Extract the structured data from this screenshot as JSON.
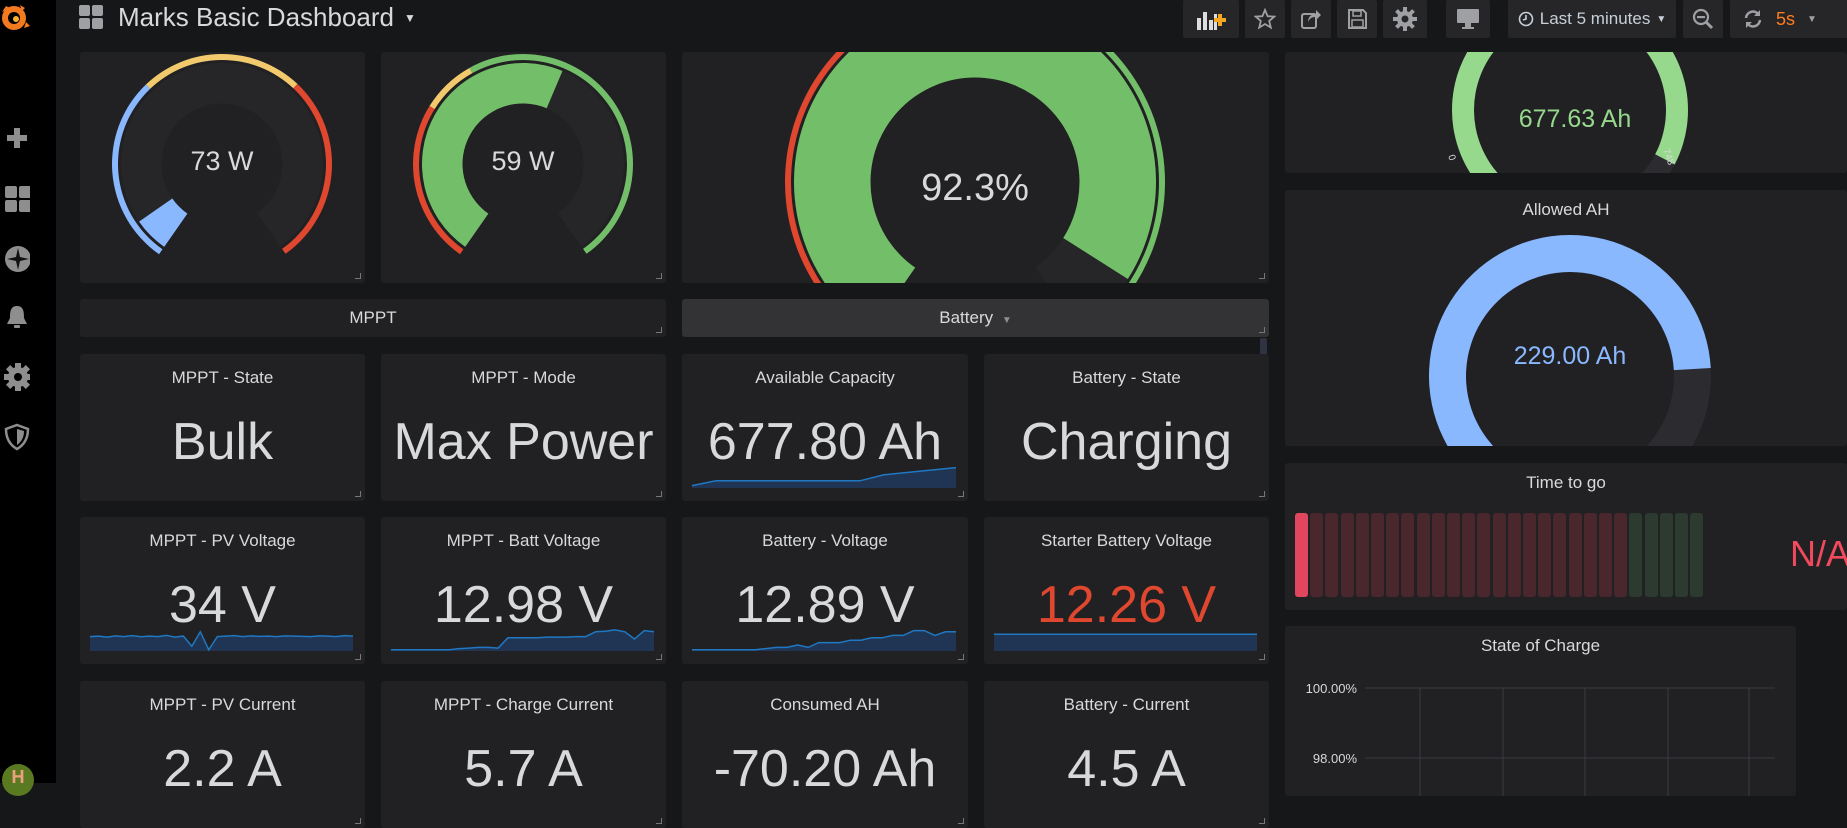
{
  "header": {
    "title": "Marks Basic Dashboard",
    "time_range": "Last 5 minutes",
    "refresh_interval": "5s",
    "buttons": [
      "add-panel",
      "star",
      "share",
      "save",
      "settings",
      "cycle-view-mode",
      "zoom-out",
      "refresh"
    ]
  },
  "sidebar": {
    "items": [
      "create",
      "dashboards",
      "explore",
      "alerting",
      "configuration",
      "server-admin"
    ],
    "user_initial": "H"
  },
  "colors": {
    "green": "#73bf69",
    "light_green": "#96d98d",
    "blue": "#8ab8ff",
    "red": "#e0472f",
    "yellow": "#f2c96d",
    "na_red": "#f2495c",
    "orange": "#ff7c1f"
  },
  "gauges": {
    "mppt_power_1": {
      "value_text": "73 W",
      "fraction": 0.07
    },
    "mppt_power_2": {
      "value_text": "59 W",
      "fraction": 0.58
    },
    "soc_gauge": {
      "value_text": "92.3%",
      "fraction": 0.923
    },
    "available_capacity_gauge": {
      "value_text": "677.63 Ah",
      "min_label": "0",
      "max_label": "748",
      "fraction": 0.906
    },
    "allowed_ah": {
      "title": "Allowed AH",
      "value_text": "229.00 Ah",
      "fraction": 0.8
    }
  },
  "rows": {
    "mppt": {
      "label": "MPPT"
    },
    "battery": {
      "label": "Battery"
    }
  },
  "stats": {
    "mppt_state": {
      "title": "MPPT - State",
      "value": "Bulk"
    },
    "mppt_mode": {
      "title": "MPPT - Mode",
      "value": "Max Power"
    },
    "available_capacity": {
      "title": "Available Capacity",
      "value": "677.80 Ah",
      "spark": [
        0.1,
        0.3,
        0.3,
        0.3,
        0.3,
        0.3,
        0.3,
        0.3,
        0.55,
        0.65,
        0.75,
        0.85
      ]
    },
    "battery_state": {
      "title": "Battery - State",
      "value": "Charging"
    },
    "pv_voltage": {
      "title": "MPPT - PV Voltage",
      "value": "34 V",
      "spark": [
        0.6,
        0.62,
        0.58,
        0.63,
        0.6,
        0.64,
        0.59,
        0.62,
        0.6,
        0.65,
        0.58,
        0.62,
        0.2,
        0.8,
        0.05,
        0.6,
        0.62,
        0.64,
        0.6,
        0.63,
        0.61,
        0.62,
        0.6,
        0.63,
        0.62,
        0.61,
        0.6,
        0.63,
        0.62,
        0.6,
        0.64,
        0.62
      ]
    },
    "batt_voltage": {
      "title": "MPPT - Batt Voltage",
      "value": "12.98 V",
      "spark": [
        0.05,
        0.05,
        0.05,
        0.05,
        0.05,
        0.05,
        0.05,
        0.1,
        0.12,
        0.15,
        0.15,
        0.12,
        0.55,
        0.55,
        0.55,
        0.55,
        0.58,
        0.58,
        0.58,
        0.6,
        0.6,
        0.8,
        0.82,
        0.88,
        0.8,
        0.5,
        0.85,
        0.8
      ]
    },
    "battery_voltage": {
      "title": "Battery - Voltage",
      "value": "12.89 V",
      "spark": [
        0.05,
        0.05,
        0.05,
        0.05,
        0.05,
        0.05,
        0.05,
        0.1,
        0.15,
        0.15,
        0.25,
        0.15,
        0.35,
        0.35,
        0.35,
        0.45,
        0.45,
        0.55,
        0.55,
        0.65,
        0.65,
        0.85,
        0.85,
        0.65,
        0.8,
        0.8
      ]
    },
    "starter_voltage": {
      "title": "Starter Battery Voltage",
      "value": "12.26 V",
      "value_color": "#e0472f",
      "spark": [
        0.7,
        0.7,
        0.7,
        0.7,
        0.7,
        0.7,
        0.7,
        0.7
      ]
    },
    "pv_current": {
      "title": "MPPT - PV Current",
      "value": "2.2 A"
    },
    "charge_current": {
      "title": "MPPT - Charge Current",
      "value": "5.7 A"
    },
    "consumed_ah": {
      "title": "Consumed AH",
      "value": "-70.20 Ah"
    },
    "battery_current": {
      "title": "Battery - Current",
      "value": "4.5 A"
    }
  },
  "time_to_go": {
    "title": "Time to go",
    "value": "N/A",
    "bar_count": 27,
    "red_cells": 22,
    "lit_cells": 1
  },
  "chart_data": {
    "type": "line",
    "title": "State of Charge",
    "ytick_labels": [
      "100.00%",
      "98.00%"
    ],
    "ylim": [
      98,
      100
    ],
    "series": [],
    "grid": true
  }
}
